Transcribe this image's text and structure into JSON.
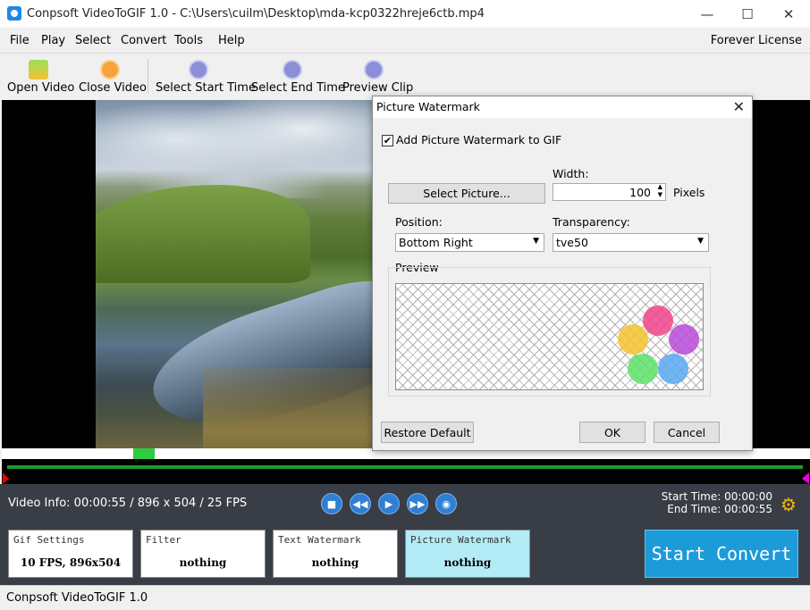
{
  "window": {
    "title": "Conpsoft VideoToGIF 1.0 - C:\\Users\\cuilm\\Desktop\\mda-kcp0322hreje6ctb.mp4",
    "minimize": "—",
    "maximize": "☐",
    "close": "✕"
  },
  "menu": {
    "items": [
      "File",
      "Play",
      "Select",
      "Convert",
      "Tools",
      "Help"
    ],
    "license": "Forever License"
  },
  "toolbar": {
    "open_video": "Open Video",
    "close_video": "Close Video",
    "select_start": "Select Start Time",
    "select_end": "Select End Time",
    "preview_clip": "Preview Clip"
  },
  "playback": {
    "video_info": "Video Info: 00:00:55 / 896 x 504 / 25 FPS",
    "start_time": "Start Time: 00:00:00",
    "end_time": "End Time: 00:00:55"
  },
  "cards": [
    {
      "title": "Gif Settings",
      "value": "10 FPS, 896x504"
    },
    {
      "title": "Filter",
      "value": "nothing"
    },
    {
      "title": "Text Watermark",
      "value": "nothing"
    },
    {
      "title": "Picture Watermark",
      "value": "nothing"
    }
  ],
  "start_convert": "Start Convert",
  "status": "Conpsoft VideoToGIF 1.0",
  "dialog": {
    "title": "Picture Watermark",
    "close": "✕",
    "add_watermark_label": "Add Picture Watermark to GIF",
    "add_watermark_checked": true,
    "check_mark": "✔",
    "width_label": "Width:",
    "width_value": "100",
    "pixels_label": "Pixels",
    "select_picture": "Select Picture...",
    "position_label": "Position:",
    "position_value": "Bottom Right",
    "transparency_label": "Transparency:",
    "transparency_value": "tve50",
    "preview_label": "Preview",
    "restore_default": "Restore Default",
    "ok": "OK",
    "cancel": "Cancel",
    "watermark_colors": [
      "#f0448a",
      "#f5c330",
      "#b84ad8",
      "#5de06a",
      "#58a8f0"
    ]
  }
}
